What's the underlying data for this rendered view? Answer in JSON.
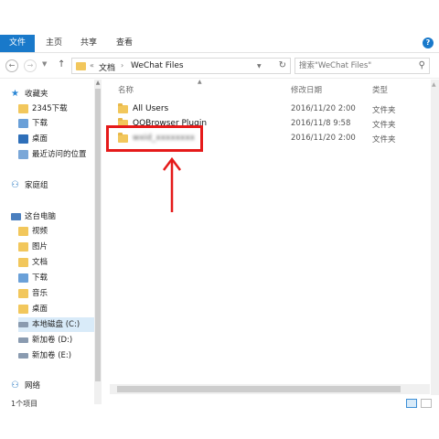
{
  "ribbon": {
    "file_tab": "文件",
    "tabs": [
      "主页",
      "共享",
      "查看"
    ],
    "help": "?"
  },
  "nav": {
    "back": "←",
    "forward": "→",
    "up": "↑",
    "breadcrumb_prefix": "«",
    "path": [
      "文档",
      "WeChat Files"
    ],
    "separator": "›",
    "refresh": "↻",
    "search_placeholder": "搜索\"WeChat Files\"",
    "search_icon": "⚲"
  },
  "sidebar": {
    "items": [
      {
        "label": "收藏夹",
        "icon": "star-icon"
      },
      {
        "label": "2345下载",
        "icon": "folder-icon"
      },
      {
        "label": "下载",
        "icon": "folder-icon"
      },
      {
        "label": "桌面",
        "icon": "desktop-icon"
      },
      {
        "label": "最近访问的位置",
        "icon": "recent-icon"
      },
      {
        "label": "家庭组",
        "icon": "homegroup-icon"
      },
      {
        "label": "这台电脑",
        "icon": "pc-icon"
      },
      {
        "label": "视频",
        "icon": "folder-icon"
      },
      {
        "label": "图片",
        "icon": "folder-icon"
      },
      {
        "label": "文档",
        "icon": "folder-icon"
      },
      {
        "label": "下载",
        "icon": "folder-icon"
      },
      {
        "label": "音乐",
        "icon": "folder-icon"
      },
      {
        "label": "桌面",
        "icon": "desktop-icon"
      },
      {
        "label": "本地磁盘 (C:)",
        "icon": "drive-icon"
      },
      {
        "label": "新加卷 (D:)",
        "icon": "drive-icon"
      },
      {
        "label": "新加卷 (E:)",
        "icon": "drive-icon"
      },
      {
        "label": "网络",
        "icon": "network-icon"
      },
      {
        "label": "1个项目",
        "icon": ""
      }
    ]
  },
  "columns": {
    "name": "名称",
    "date": "修改日期",
    "type": "类型"
  },
  "files": [
    {
      "name": "All Users",
      "date": "2016/11/20 2:00",
      "type": "文件夹"
    },
    {
      "name": "QQBrowser Plugin",
      "date": "2016/11/8 9:58",
      "type": "文件夹"
    },
    {
      "name": "wxid_xxxxxxxx",
      "date": "2016/11/20 2:00",
      "type": "文件夹"
    }
  ],
  "colors": {
    "accent": "#1979ca",
    "folder": "#f2c75c",
    "highlight": "#e51a1a",
    "selection": "#d9ebf9"
  }
}
